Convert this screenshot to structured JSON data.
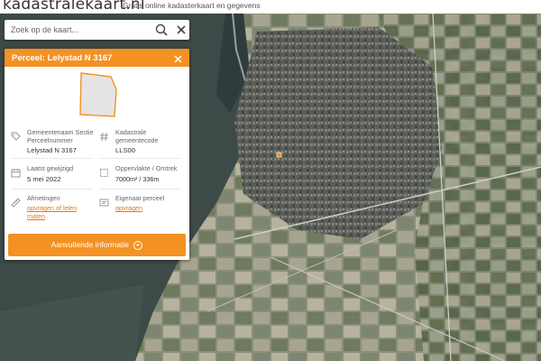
{
  "header": {
    "logo": "kadastralekaart.nl",
    "tagline": "Gratis online kadasterkaart en gegevens"
  },
  "search": {
    "placeholder": "Zoek op de kaart...",
    "search_icon": "search-icon",
    "close_icon": "close-icon"
  },
  "panel": {
    "title": "Perceel: Lelystad N 3167",
    "close_icon": "close-icon",
    "fields": {
      "gemeente": {
        "icon": "tag-icon",
        "label_1": "Gemeentenaam Sectie",
        "label_2": "Perceelnummer",
        "value": "Lelystad N 3167"
      },
      "code": {
        "icon": "hash-icon",
        "label_1": "Kadastrale",
        "label_2": "gemeentecode",
        "value": "LLS00"
      },
      "date": {
        "icon": "calendar-icon",
        "label": "Laatst gewijzigd",
        "value": "5 mei 2022"
      },
      "area": {
        "icon": "area-icon",
        "label": "Oppervlakte / Omtrek",
        "value": "7000m² / 336m"
      },
      "measure": {
        "icon": "ruler-icon",
        "label": "Afmetingen",
        "link_1": "opvragen of lelen",
        "link_2": "maten"
      },
      "owner": {
        "icon": "id-card-icon",
        "label": "Eigenaar perceel",
        "link": "opvragen"
      }
    },
    "more_button": "Aanvullende informatie"
  },
  "colors": {
    "accent": "#f39223",
    "link": "#e0781a"
  }
}
